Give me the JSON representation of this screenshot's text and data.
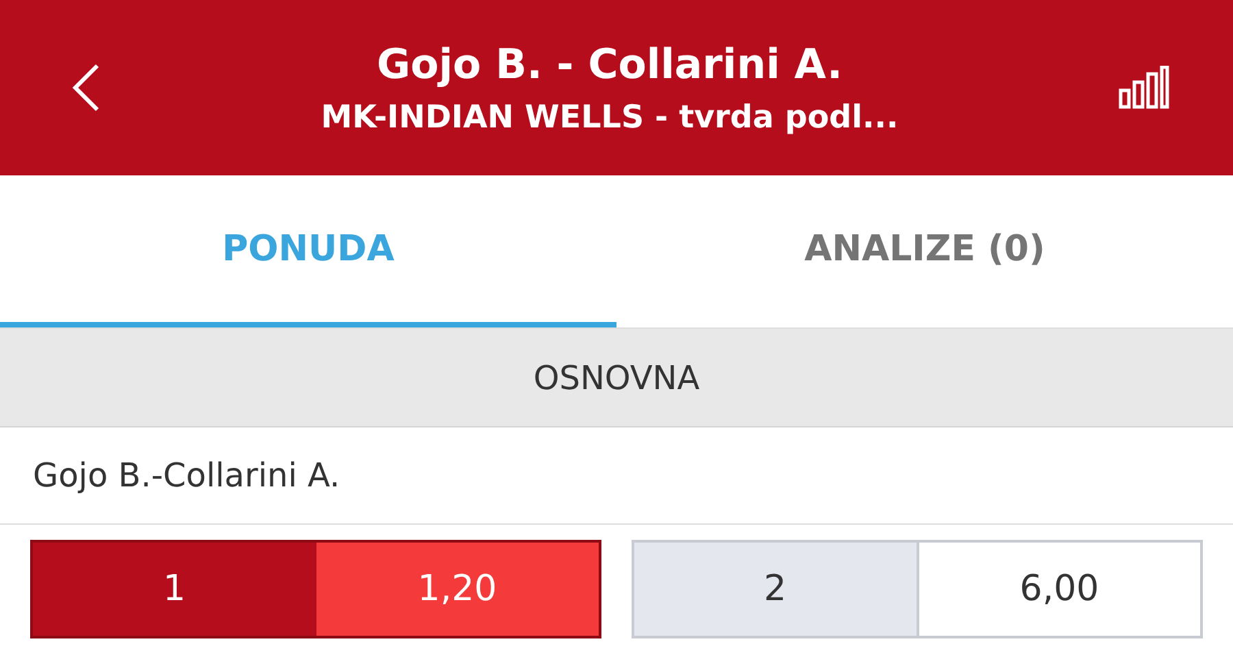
{
  "header": {
    "title": "Gojo B. - Collarini A.",
    "subtitle": "MK-INDIAN WELLS - tvrda podl..."
  },
  "tabs": [
    {
      "label": "PONUDA",
      "selected": true
    },
    {
      "label": "ANALIZE (0)",
      "selected": false
    }
  ],
  "section": {
    "title": "OSNOVNA"
  },
  "market": {
    "title": "Gojo B.-Collarini A.",
    "outcomes": [
      {
        "label": "1",
        "odds": "1,20",
        "selected": true
      },
      {
        "label": "2",
        "odds": "6,00",
        "selected": false
      }
    ]
  }
}
